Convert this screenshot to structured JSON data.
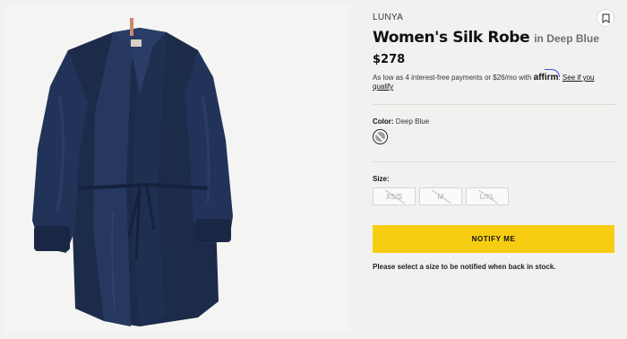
{
  "product": {
    "brand": "LUNYA",
    "title": "Women's Silk Robe",
    "variant_text": "in Deep Blue",
    "price": "$278",
    "financing": {
      "text": "As low as 4 interest-free payments or $26/mo with",
      "provider": "affirm",
      "link_text": "See if you qualify"
    },
    "color": {
      "label": "Color:",
      "value": "Deep Blue",
      "swatch_color": "#9aa0a4"
    },
    "size": {
      "label": "Size:",
      "options": [
        "XS/S",
        "M",
        "L/XL"
      ]
    },
    "notify_button": "NOTIFY ME",
    "notice": "Please select a size to be notified when back in stock."
  },
  "colors": {
    "robe": "#1f2e4f",
    "accent_button": "#f6cd12",
    "background": "#f1f2f0"
  },
  "icons": {
    "bookmark": "bookmark-icon"
  }
}
